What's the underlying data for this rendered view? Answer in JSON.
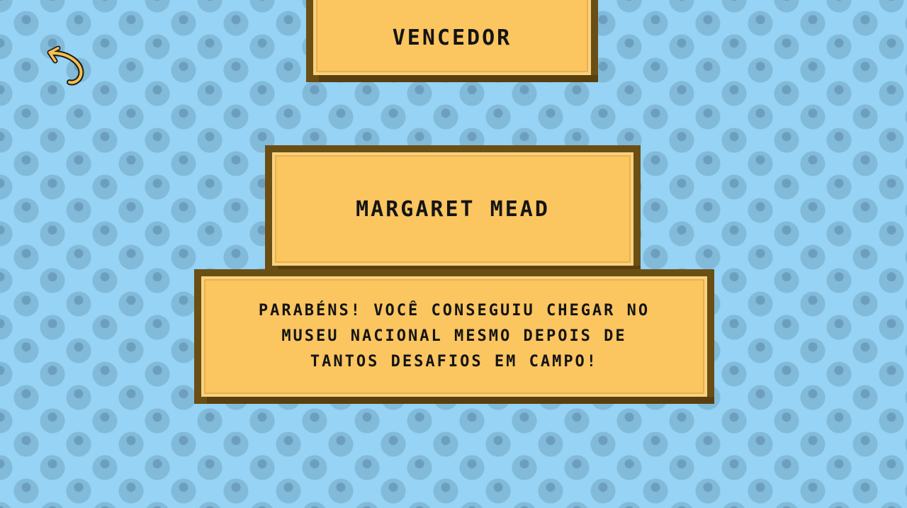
{
  "screen": {
    "title": "VENCEDOR",
    "winner_name": "MARGARET MEAD",
    "message_lines": [
      "PARABÉNS! VOCÊ CONSEGUIU CHEGAR NO",
      "MUSEU NACIONAL MESMO DEPOIS DE",
      "TANTOS DESAFIOS EM CAMPO!"
    ]
  },
  "icons": {
    "back": "back-arrow-icon"
  },
  "colors": {
    "background": "#96d3f5",
    "panel_fill": "#fbc560",
    "panel_border": "#6b4e14",
    "text": "#141414",
    "arrow": "#f4c04f"
  }
}
